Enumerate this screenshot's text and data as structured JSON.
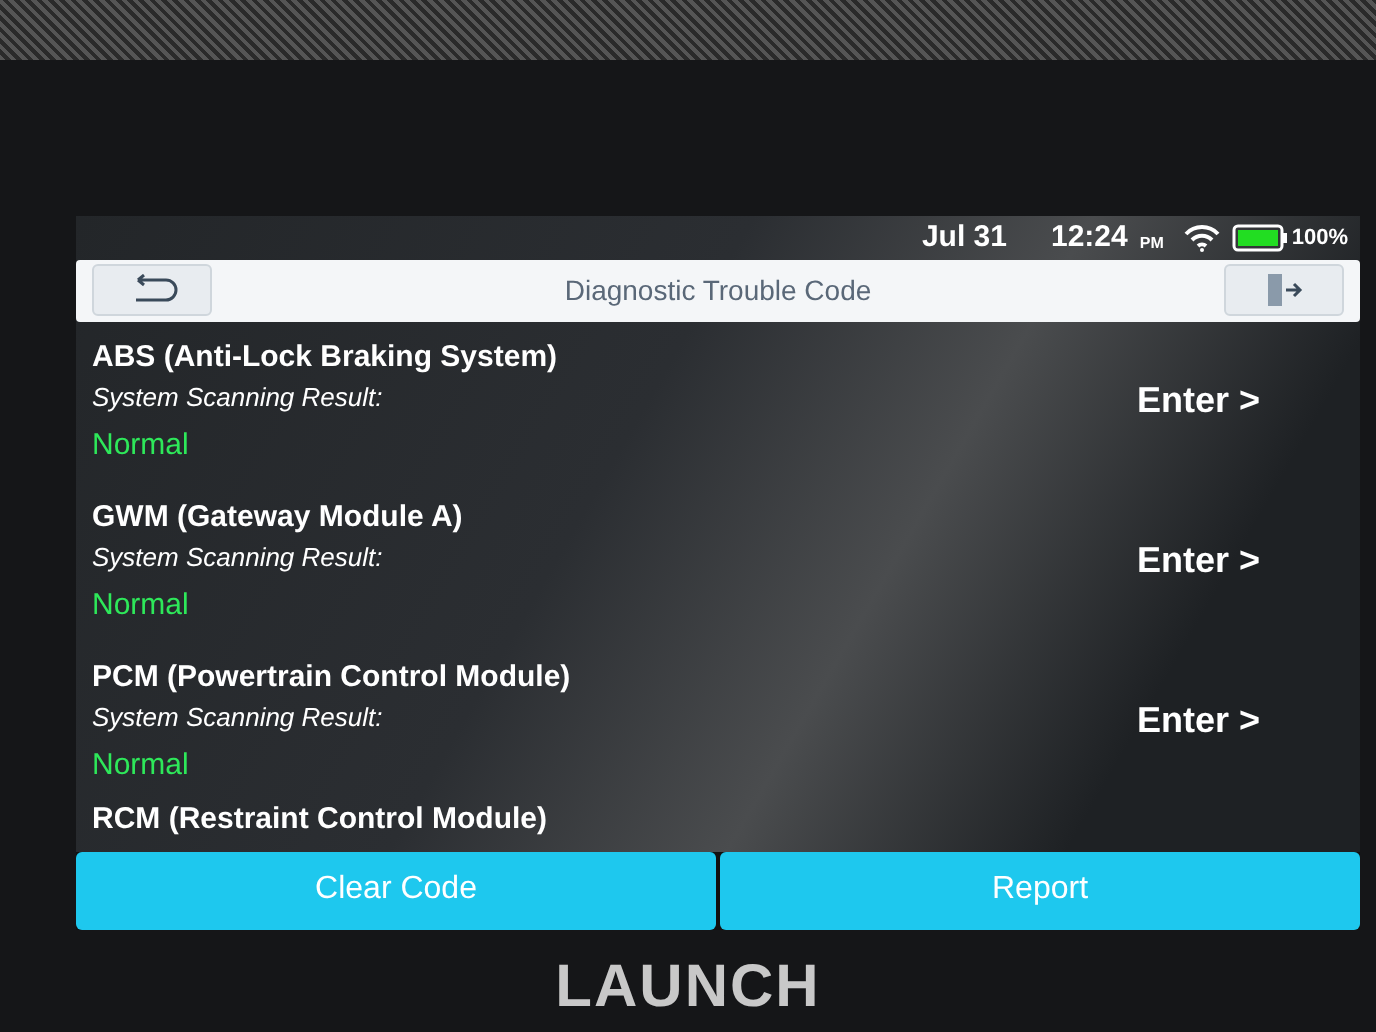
{
  "status_bar": {
    "date": "Jul 31",
    "time": "12:24",
    "meridiem": "PM",
    "battery": "100%"
  },
  "header": {
    "title": "Diagnostic Trouble Code"
  },
  "systems": [
    {
      "name": "ABS (Anti-Lock Braking System)",
      "result_label": "System Scanning Result:",
      "result": "Normal",
      "action": "Enter >"
    },
    {
      "name": "GWM (Gateway Module A)",
      "result_label": "System Scanning Result:",
      "result": "Normal",
      "action": "Enter >"
    },
    {
      "name": "PCM (Powertrain Control Module)",
      "result_label": "System Scanning Result:",
      "result": "Normal",
      "action": "Enter >"
    },
    {
      "name": "RCM (Restraint Control Module)"
    }
  ],
  "buttons": [
    "Clear Code",
    "Report"
  ],
  "device": {
    "brand": "LAUNCH"
  }
}
